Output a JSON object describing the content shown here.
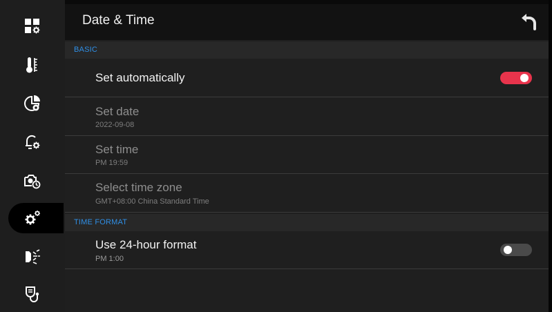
{
  "header": {
    "title": "Date & Time"
  },
  "sidebar": {
    "items": [
      {
        "icon": "apps-settings-icon"
      },
      {
        "icon": "thermometer-icon"
      },
      {
        "icon": "pie-chart-settings-icon"
      },
      {
        "icon": "alarm-settings-icon"
      },
      {
        "icon": "camera-timer-icon"
      },
      {
        "icon": "gears-icon",
        "active": true
      },
      {
        "icon": "display-scan-icon"
      },
      {
        "icon": "stethoscope-icon"
      }
    ]
  },
  "sections": {
    "basic": {
      "title": "BASIC",
      "set_automatically": {
        "label": "Set automatically",
        "enabled": true
      },
      "set_date": {
        "label": "Set date",
        "value": "2022-09-08"
      },
      "set_time": {
        "label": "Set time",
        "value": "PM 19:59"
      },
      "time_zone": {
        "label": "Select time zone",
        "value": "GMT+08:00 China Standard Time"
      }
    },
    "time_format": {
      "title": "TIME FORMAT",
      "use_24_hour": {
        "label": "Use 24-hour format",
        "value": "PM 1:00",
        "enabled": false
      }
    }
  },
  "colors": {
    "accent_red": "#e8344c",
    "section_blue": "#2f8fe6"
  }
}
